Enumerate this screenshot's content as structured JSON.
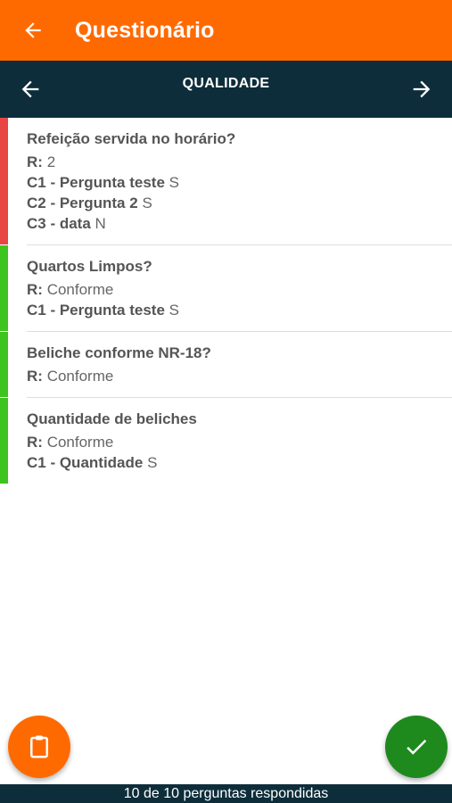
{
  "appbar": {
    "title": "Questionário",
    "back_icon": "arrow-left-icon",
    "color": "#ff6a00"
  },
  "section": {
    "title": "QUALIDADE",
    "prev_icon": "arrow-left-icon",
    "next_icon": "arrow-right-icon",
    "color": "#0d2d3a"
  },
  "items": [
    {
      "question": "Refeição servida no horário?",
      "status_color": "#e84545",
      "answer_label": "R:",
      "answer": "2",
      "extras": [
        {
          "label": "C1 - Pergunta teste",
          "value": "S"
        },
        {
          "label": "C2 - Pergunta 2",
          "value": "S"
        },
        {
          "label": "C3 - data",
          "value": "N"
        }
      ]
    },
    {
      "question": "Quartos Limpos?",
      "status_color": "#3ec41e",
      "answer_label": "R:",
      "answer": "Conforme",
      "extras": [
        {
          "label": "C1 - Pergunta teste",
          "value": "S"
        }
      ]
    },
    {
      "question": "Beliche conforme NR-18?",
      "status_color": "#3ec41e",
      "answer_label": "R:",
      "answer": "Conforme",
      "extras": []
    },
    {
      "question": "Quantidade de beliches",
      "status_color": "#3ec41e",
      "answer_label": "R:",
      "answer": "Conforme",
      "extras": [
        {
          "label": "C1 - Quantidade",
          "value": "S"
        }
      ]
    }
  ],
  "fab_left": {
    "icon": "clipboard-icon",
    "color": "#ff6a00"
  },
  "fab_right": {
    "icon": "check-icon",
    "color": "#1e8a1e"
  },
  "footer": {
    "text": "10 de 10 perguntas respondidas"
  }
}
